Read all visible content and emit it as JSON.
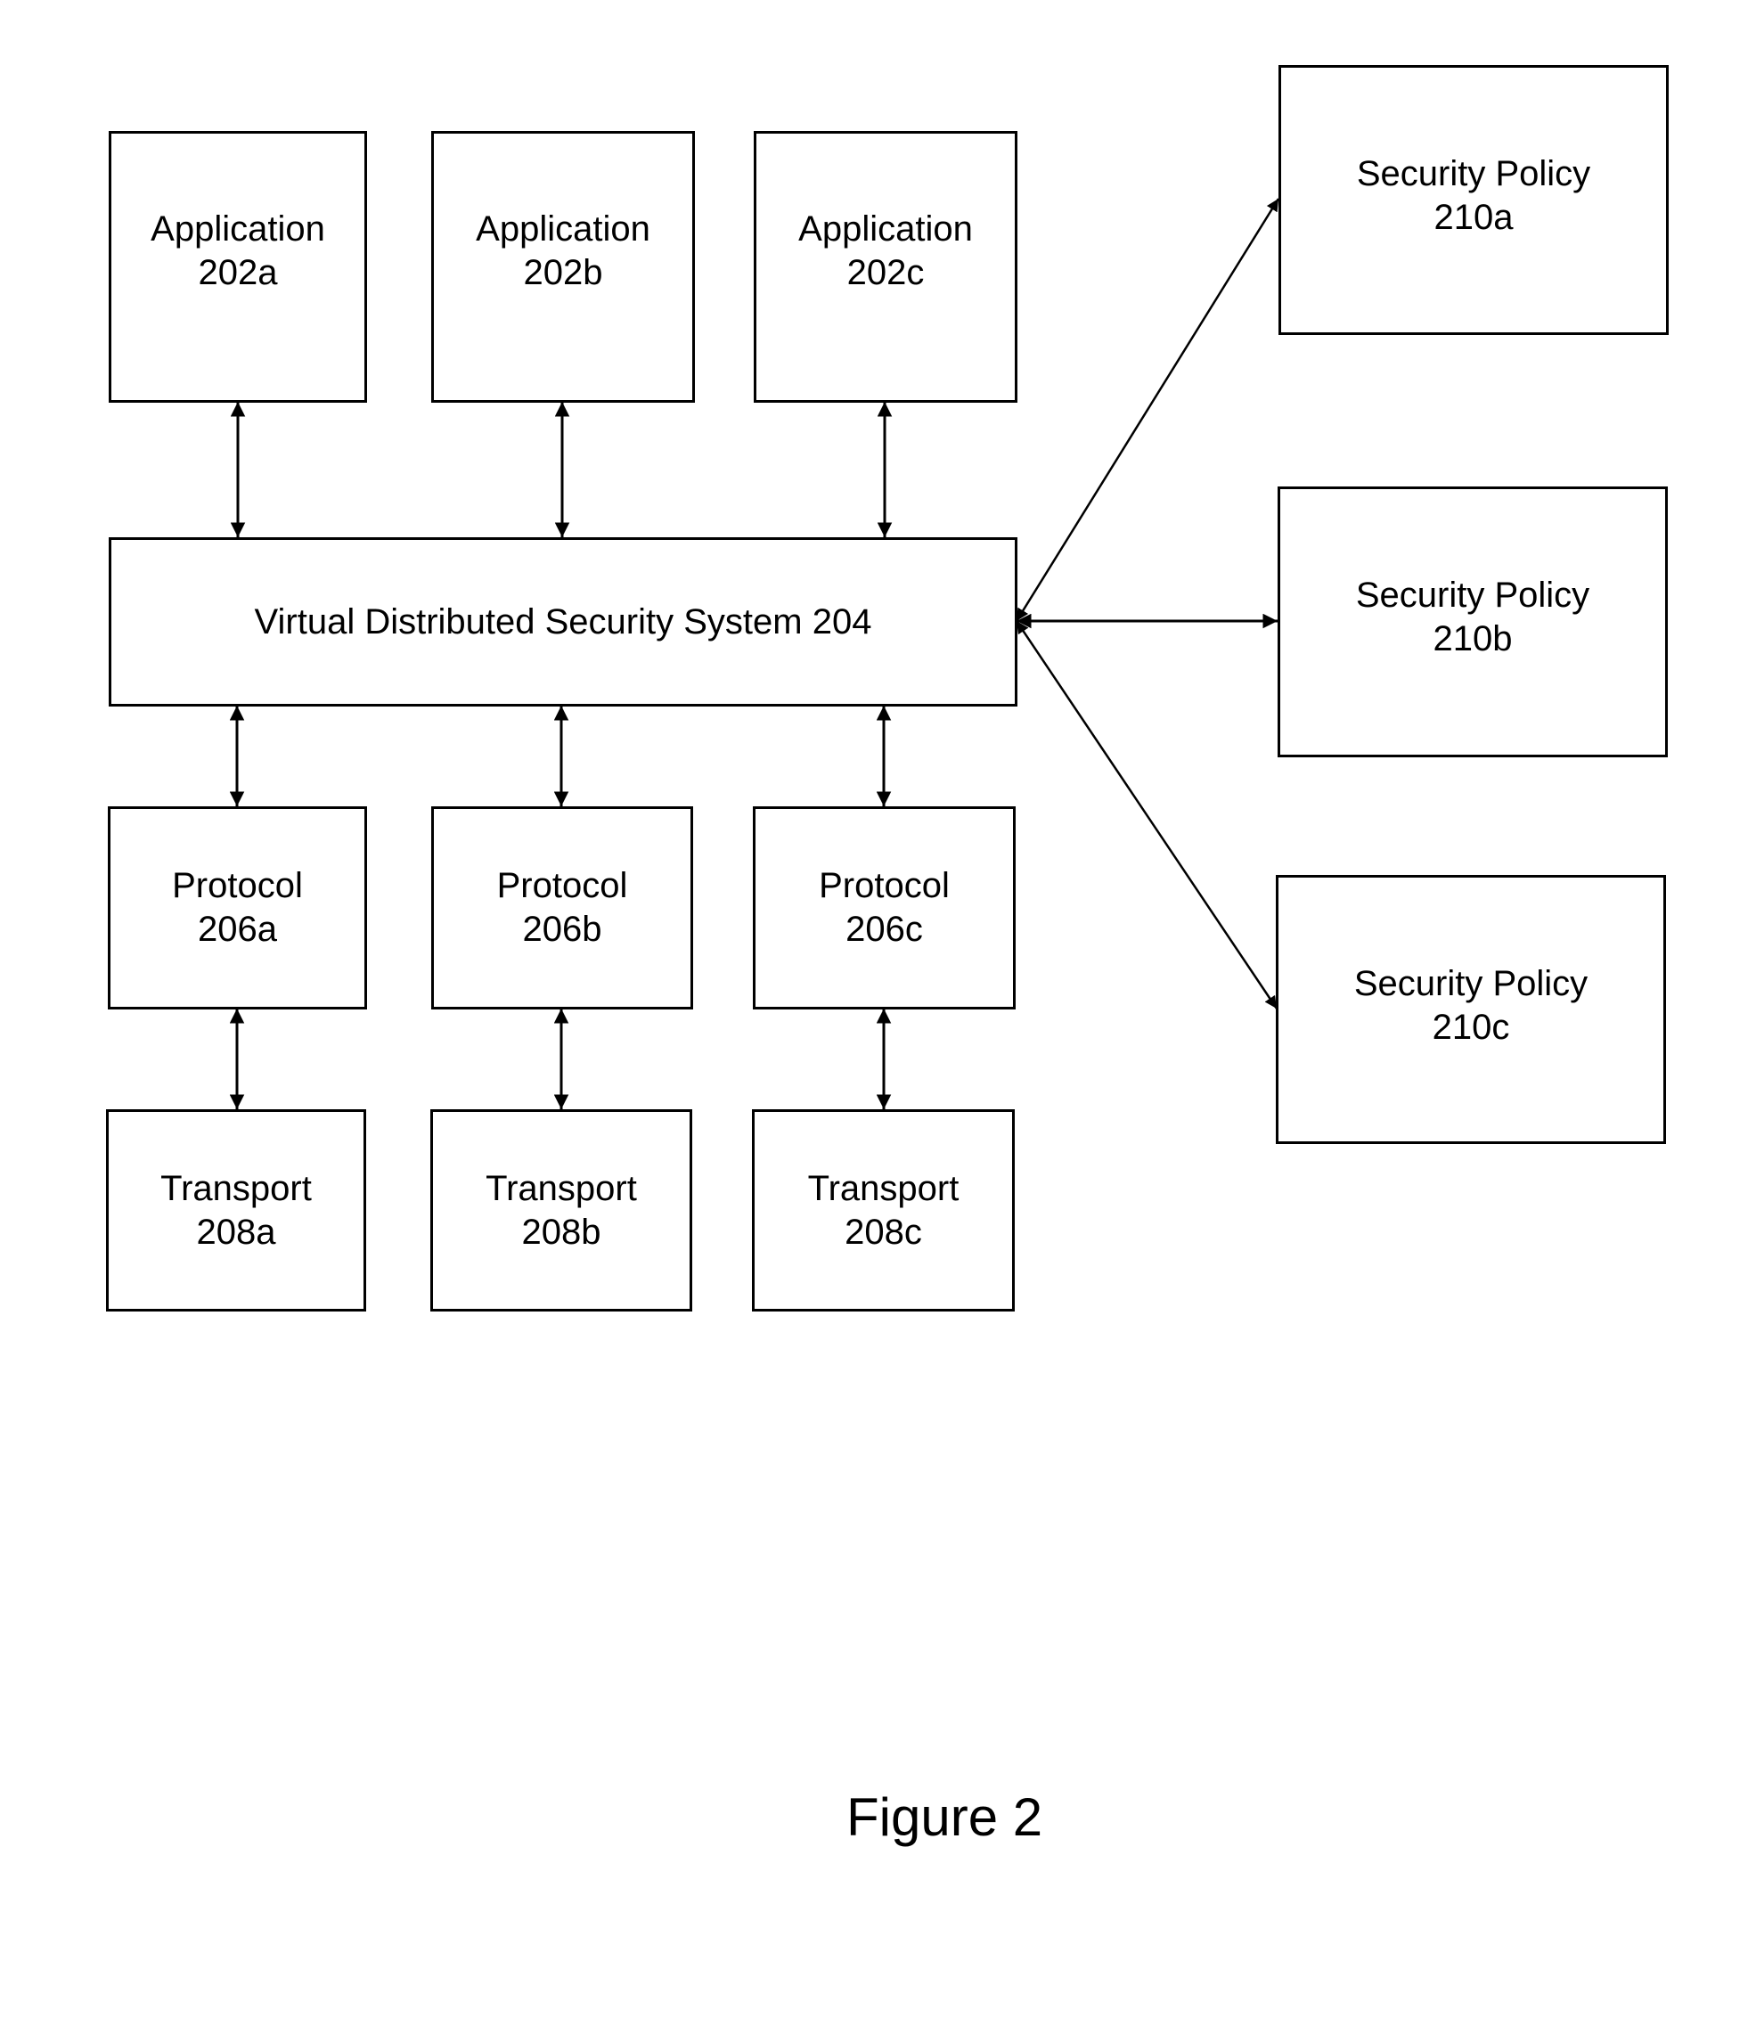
{
  "figure": {
    "caption": "Figure 2",
    "line_color": "#000000",
    "background": "#ffffff"
  },
  "applications": [
    {
      "title": "Application",
      "ref": "202a"
    },
    {
      "title": "Application",
      "ref": "202b"
    },
    {
      "title": "Application",
      "ref": "202c"
    }
  ],
  "security_system": {
    "label": "Virtual Distributed Security System 204"
  },
  "protocols": [
    {
      "title": "Protocol",
      "ref": "206a"
    },
    {
      "title": "Protocol",
      "ref": "206b"
    },
    {
      "title": "Protocol",
      "ref": "206c"
    }
  ],
  "transports": [
    {
      "title": "Transport",
      "ref": "208a"
    },
    {
      "title": "Transport",
      "ref": "208b"
    },
    {
      "title": "Transport",
      "ref": "208c"
    }
  ],
  "security_policies": [
    {
      "title": "Security Policy",
      "ref": "210a"
    },
    {
      "title": "Security Policy",
      "ref": "210b"
    },
    {
      "title": "Security Policy",
      "ref": "210c"
    }
  ],
  "connections": [
    {
      "from": "Application 202a",
      "to": "Virtual Distributed Security System 204",
      "direction": "bidirectional"
    },
    {
      "from": "Application 202b",
      "to": "Virtual Distributed Security System 204",
      "direction": "bidirectional"
    },
    {
      "from": "Application 202c",
      "to": "Virtual Distributed Security System 204",
      "direction": "bidirectional"
    },
    {
      "from": "Virtual Distributed Security System 204",
      "to": "Protocol 206a",
      "direction": "bidirectional"
    },
    {
      "from": "Virtual Distributed Security System 204",
      "to": "Protocol 206b",
      "direction": "bidirectional"
    },
    {
      "from": "Virtual Distributed Security System 204",
      "to": "Protocol 206c",
      "direction": "bidirectional"
    },
    {
      "from": "Protocol 206a",
      "to": "Transport 208a",
      "direction": "bidirectional"
    },
    {
      "from": "Protocol 206b",
      "to": "Transport 208b",
      "direction": "bidirectional"
    },
    {
      "from": "Protocol 206c",
      "to": "Transport 208c",
      "direction": "bidirectional"
    },
    {
      "from": "Virtual Distributed Security System 204",
      "to": "Security Policy 210a",
      "direction": "bidirectional"
    },
    {
      "from": "Virtual Distributed Security System 204",
      "to": "Security Policy 210b",
      "direction": "bidirectional"
    },
    {
      "from": "Virtual Distributed Security System 204",
      "to": "Security Policy 210c",
      "direction": "bidirectional"
    }
  ]
}
